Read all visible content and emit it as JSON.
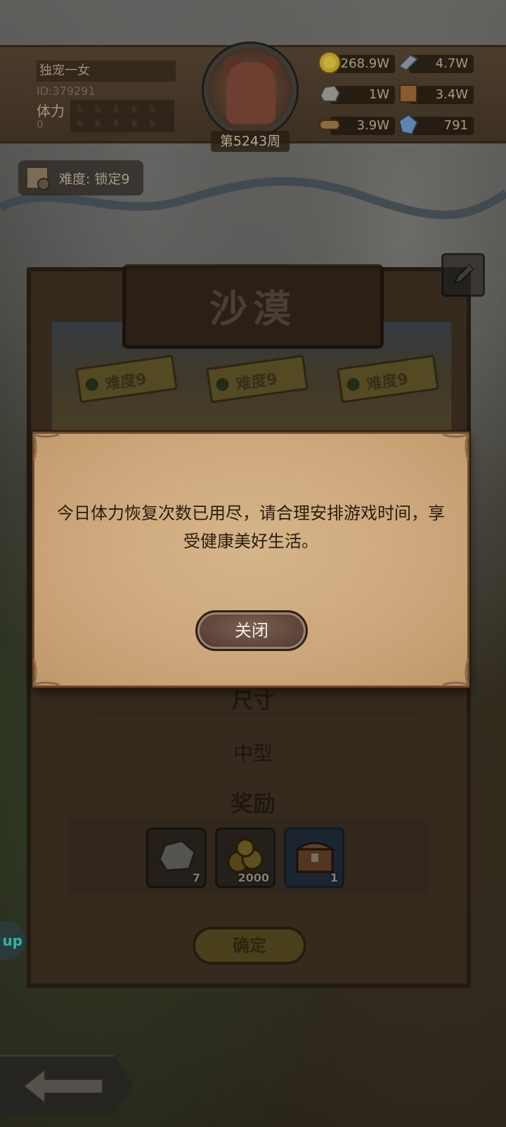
{
  "header": {
    "player_name": "独宠一女",
    "player_id": "ID:379291",
    "stamina_label": "体力",
    "stamina_value": "0",
    "week_label": "第5243周",
    "resources": [
      {
        "icon": "gold-coin-icon",
        "value": "268.9W"
      },
      {
        "icon": "iron-bar-icon",
        "value": "4.7W"
      },
      {
        "icon": "stone-icon",
        "value": "1W"
      },
      {
        "icon": "leather-icon",
        "value": "3.4W"
      },
      {
        "icon": "wood-log-icon",
        "value": "3.9W"
      },
      {
        "icon": "crystal-icon",
        "value": "791"
      }
    ]
  },
  "difficulty_tag": "难度: 锁定9",
  "level": {
    "title": "沙漠",
    "difficulty_cards": [
      "难度9",
      "难度9",
      "难度9"
    ],
    "size_label": "尺寸",
    "size_value": "中型",
    "reward_label": "奖励",
    "rewards": [
      {
        "icon": "stone-icon",
        "count": "7"
      },
      {
        "icon": "gold-coins-icon",
        "count": "2000"
      },
      {
        "icon": "treasure-chest-icon",
        "count": "1"
      }
    ],
    "confirm_label": "确定"
  },
  "side_pill_label": "up",
  "modal": {
    "message": "今日体力恢复次数已用尽，请合理安排游戏时间，享受健康美好生活。",
    "close_label": "关闭"
  },
  "colors": {
    "modal_paper": "#d6b58a",
    "modal_text": "#2a1c10",
    "close_button": "#5c4438",
    "header_bg": "#3a2d1e"
  }
}
